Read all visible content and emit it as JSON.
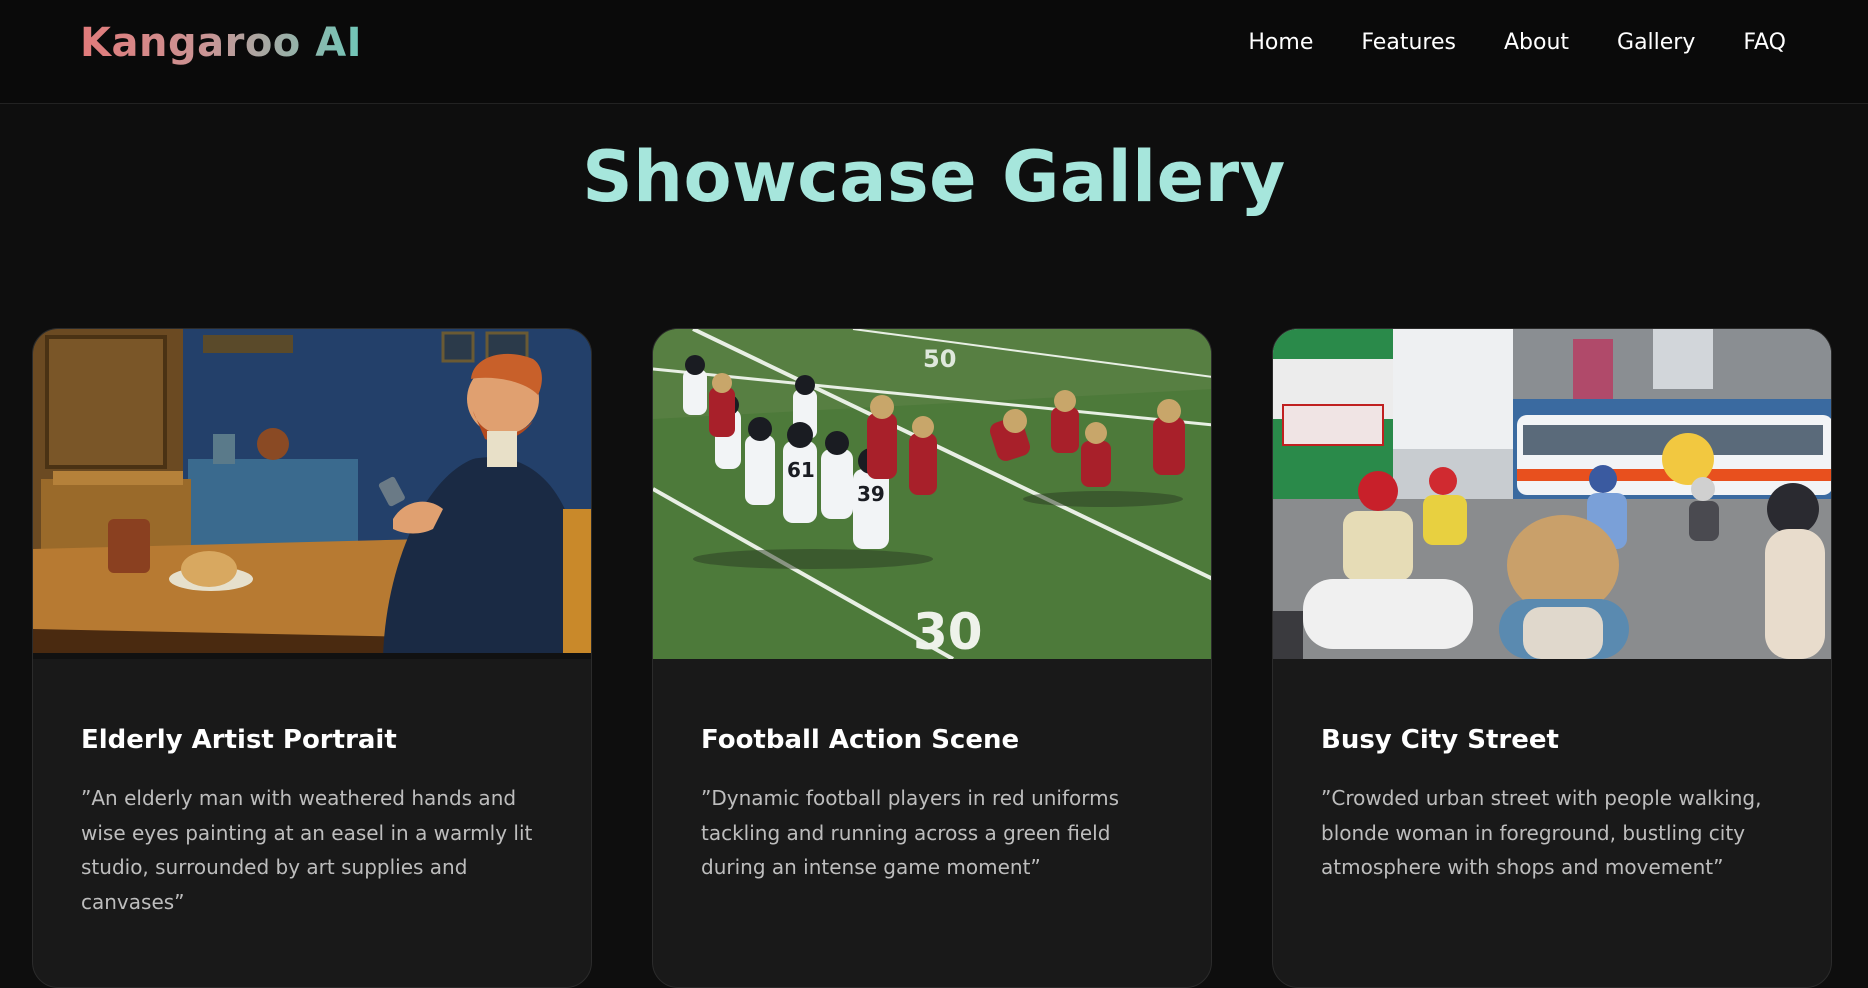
{
  "nav": {
    "logo": "Kangaroo AI",
    "links": [
      "Home",
      "Features",
      "About",
      "Gallery",
      "FAQ"
    ]
  },
  "page": {
    "title": "Showcase Gallery"
  },
  "cards": [
    {
      "title": "Elderly Artist Portrait",
      "description": "”An elderly man with weathered hands and wise eyes painting at an easel in a warmly lit studio, surrounded by art supplies and canvases”"
    },
    {
      "title": "Football Action Scene",
      "description": "”Dynamic football players in red uniforms tackling and running across a green field during an intense game moment”"
    },
    {
      "title": "Busy City Street",
      "description": "”Crowded urban street with people walking, blonde woman in foreground, bustling city atmosphere with shops and movement”"
    }
  ],
  "colors": {
    "background": "#0e0e0e",
    "nav_background": "#0a0a0a",
    "card_background": "#191919",
    "title_accent": "#a6e6dc",
    "logo_gradient_start": "#e27a7a",
    "logo_gradient_end": "#6fc7b8"
  }
}
